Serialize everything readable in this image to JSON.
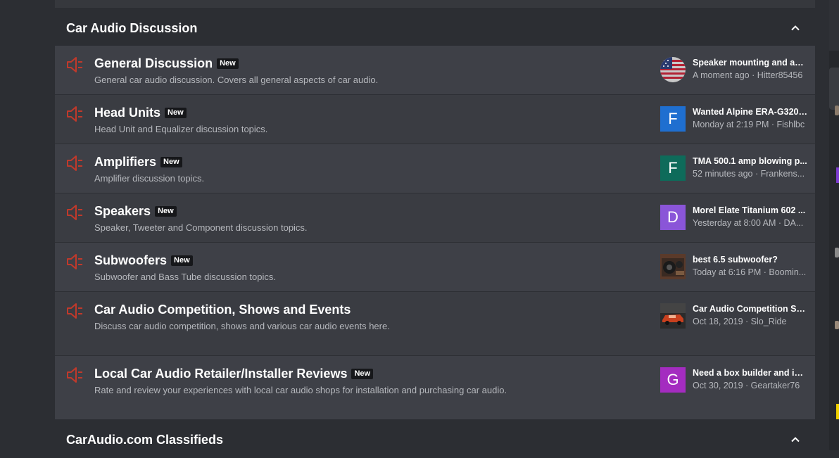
{
  "categories": [
    {
      "title": "Car Audio Discussion",
      "forums": [
        {
          "title": "General Discussion",
          "badge": "New",
          "description": "General car audio discussion. Covers all general aspects of car audio.",
          "latest_title": "Speaker mounting and amp...",
          "latest_meta": "A moment ago · Hitter85456",
          "avatar_type": "flag",
          "avatar_letter": "",
          "avatar_color": ""
        },
        {
          "title": "Head Units",
          "badge": "New",
          "description": "Head Unit and Equalizer discussion topics.",
          "latest_title": "Wanted Alpine ERA-G320 ...",
          "latest_meta": "Monday at 2:19 PM · Fishlbc",
          "avatar_type": "letter",
          "avatar_letter": "F",
          "avatar_color": "#1f6fd0"
        },
        {
          "title": "Amplifiers",
          "badge": "New",
          "description": "Amplifier discussion topics.",
          "latest_title": "TMA 500.1 amp blowing p...",
          "latest_meta": "52 minutes ago · Frankens...",
          "avatar_type": "letter",
          "avatar_letter": "F",
          "avatar_color": "#0e6b5a"
        },
        {
          "title": "Speakers",
          "badge": "New",
          "description": "Speaker, Tweeter and Component discussion topics.",
          "latest_title": "Morel Elate Titanium 602 ...",
          "latest_meta": "Yesterday at 8:00 AM · DA...",
          "avatar_type": "letter",
          "avatar_letter": "D",
          "avatar_color": "#8a55d8"
        },
        {
          "title": "Subwoofers",
          "badge": "New",
          "description": "Subwoofer and Bass Tube discussion topics.",
          "latest_title": "best 6.5 subwoofer?",
          "latest_meta": "Today at 6:16 PM · Boomin...",
          "avatar_type": "photo-subwoofer",
          "avatar_letter": "",
          "avatar_color": ""
        },
        {
          "title": "Car Audio Competition, Shows and Events",
          "badge": "",
          "description": "Discuss car audio competition, shows and various car audio events here.",
          "latest_title": "Car Audio Competition SA...",
          "latest_meta": "Oct 18, 2019 · Slo_Ride",
          "avatar_type": "photo-car",
          "avatar_letter": "",
          "avatar_color": ""
        },
        {
          "title": "Local Car Audio Retailer/Installer Reviews",
          "badge": "New",
          "description": "Rate and review your experiences with local car audio shops for installation and purchasing car audio.",
          "latest_title": "Need a box builder and ins...",
          "latest_meta": "Oct 30, 2019 · Geartaker76",
          "avatar_type": "letter",
          "avatar_letter": "G",
          "avatar_color": "#a42cc0"
        }
      ]
    },
    {
      "title": "CarAudio.com Classifieds",
      "forums": []
    }
  ],
  "icons": {
    "forum_icon": "speaker-icon",
    "collapse_icon": "chevron-up-icon"
  },
  "colors": {
    "forum_icon": "#c0392b",
    "badge_bg": "#16171a"
  }
}
